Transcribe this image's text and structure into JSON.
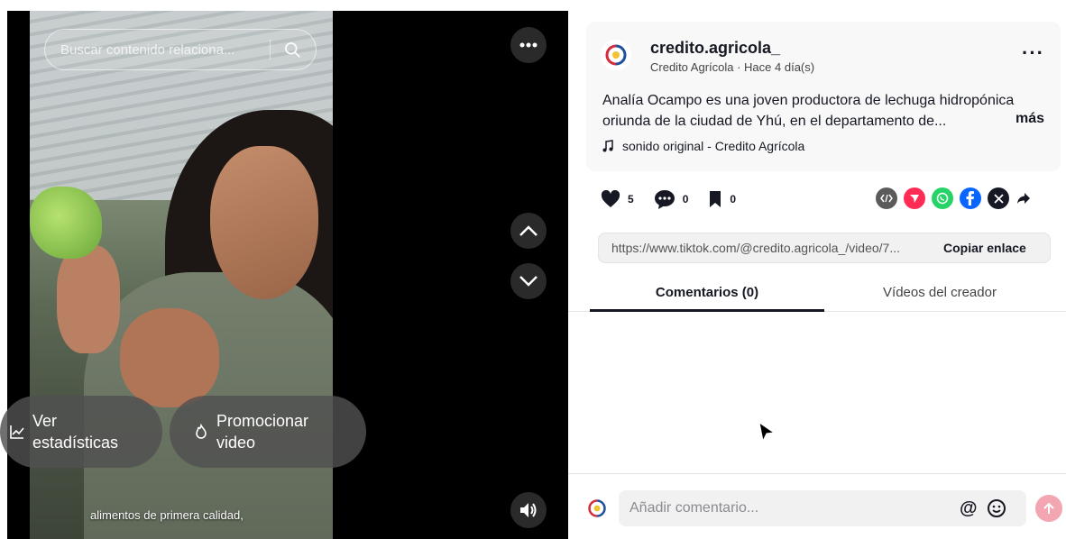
{
  "video": {
    "search_placeholder": "Buscar contenido relaciona...",
    "stats_button": {
      "line1": "Ver",
      "line2": "estadísticas"
    },
    "promote_button": {
      "line1": "Promocionar",
      "line2": "video"
    },
    "caption": "alimentos de primera calidad,",
    "icons": [
      "search-icon",
      "more-icon",
      "chevron-up-icon",
      "chevron-down-icon",
      "volume-icon",
      "chart-icon",
      "flame-icon"
    ]
  },
  "post": {
    "username": "credito.agricola_",
    "subline": "Credito Agrícola · Hace 4 día(s)",
    "description_line1": "Analía Ocampo es una joven productora de lechuga hidropónica",
    "description_line2": "oriunda de la ciudad de Yhú, en el departamento de...",
    "more_label": "más",
    "music": "sonido original - Credito Agrícola"
  },
  "actions": {
    "likes": "5",
    "comments": "0",
    "saves": "0"
  },
  "share": {
    "icons": [
      "embed-icon",
      "send-icon",
      "whatsapp-icon",
      "facebook-icon",
      "x-icon",
      "share-arrow-icon"
    ],
    "colors": {
      "embed": "#5b5b5b",
      "send": "#fe2c55",
      "whatsapp": "#25d366",
      "facebook": "#0866ff",
      "x": "#161823"
    }
  },
  "link": {
    "url": "https://www.tiktok.com/@credito.agricola_/video/7...",
    "copy_label": "Copiar enlace"
  },
  "tabs": {
    "comments": "Comentarios (0)",
    "videos": "Vídeos del creador"
  },
  "comment_box": {
    "placeholder": "Añadir comentario...",
    "at_label": "@"
  },
  "colors": {
    "accent": "#fe2c55",
    "send_disabled": "#f3a5b2"
  }
}
